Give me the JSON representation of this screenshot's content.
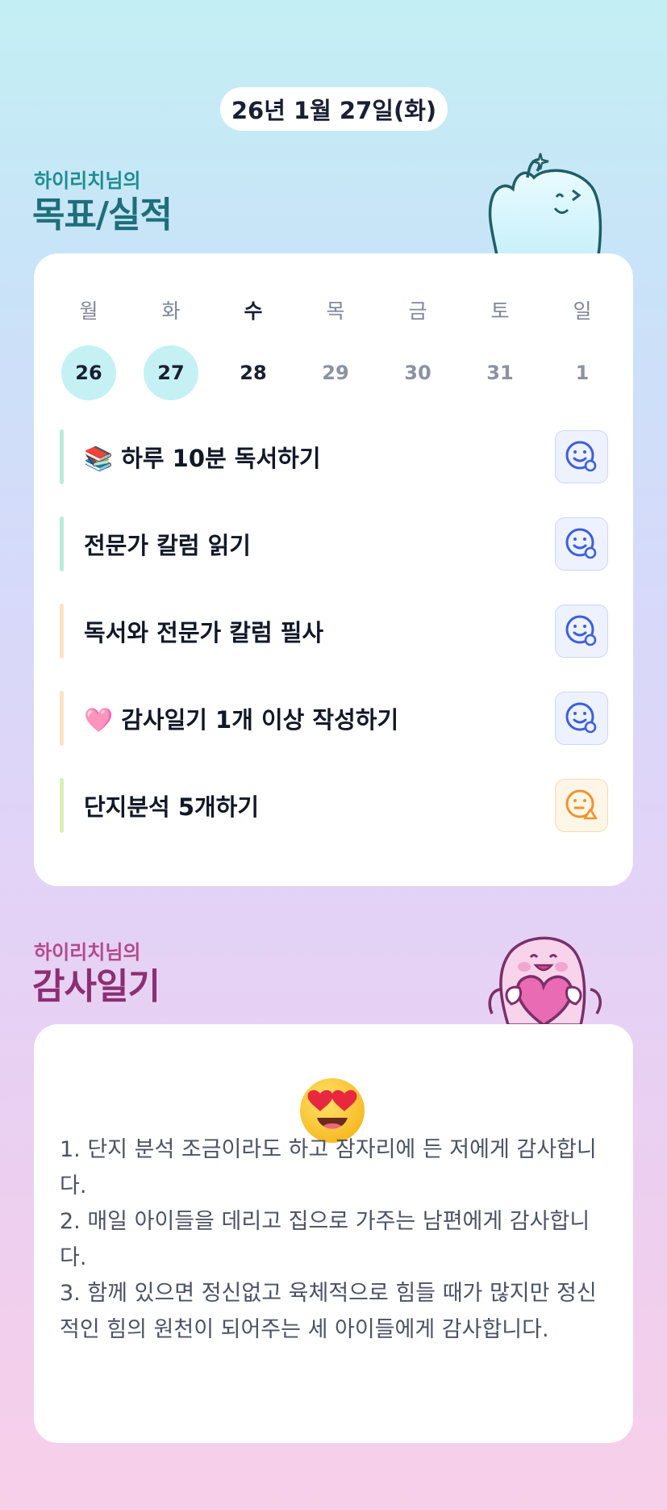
{
  "header": {
    "date": "26년 1월 27일(화)"
  },
  "goals_section": {
    "subtitle": "하이리치님의",
    "title": "목표/실적"
  },
  "week": {
    "days": [
      {
        "label": "월",
        "num": "26",
        "state": "done"
      },
      {
        "label": "화",
        "num": "27",
        "state": "done"
      },
      {
        "label": "수",
        "num": "28",
        "state": "today"
      },
      {
        "label": "목",
        "num": "29",
        "state": "future"
      },
      {
        "label": "금",
        "num": "30",
        "state": "future"
      },
      {
        "label": "토",
        "num": "31",
        "state": "future"
      },
      {
        "label": "일",
        "num": "1",
        "state": "future"
      }
    ]
  },
  "goals": [
    {
      "text": "📚 하루 10분 독서하기",
      "bar_color": "#b9ecdd",
      "status": "smile-check-icon"
    },
    {
      "text": "전문가 칼럼 읽기",
      "bar_color": "#b9ecdd",
      "status": "smile-check-icon"
    },
    {
      "text": "독서와 전문가 칼럼 필사",
      "bar_color": "#fde2c2",
      "status": "smile-check-icon"
    },
    {
      "text": "🩷 감사일기 1개 이상 작성하기",
      "bar_color": "#fde2c2",
      "status": "smile-check-icon"
    },
    {
      "text": "단지분석 5개하기",
      "bar_color": "#d9efb4",
      "status": "warning-face-icon"
    }
  ],
  "diary_section": {
    "subtitle": "하이리치님의",
    "title": "감사일기",
    "mood_icon": "heart-eyes-emoji",
    "entries": [
      "1. 단지 분석 조금이라도 하고 잠자리에 든 저에게 감사합니다.",
      "2. 매일 아이들을 데리고 집으로 가주는 남편에게 감사합니다.",
      "3. 함께 있으면 정신없고 육체적으로 힘들 때가 많지만 정신적인 힘의 원천이 되어주는 세 아이들에게 감사합니다."
    ]
  },
  "colors": {
    "done_circle": "#c6f1f4",
    "status_ok": "#3a5fe0",
    "status_warn": "#f0932b"
  }
}
